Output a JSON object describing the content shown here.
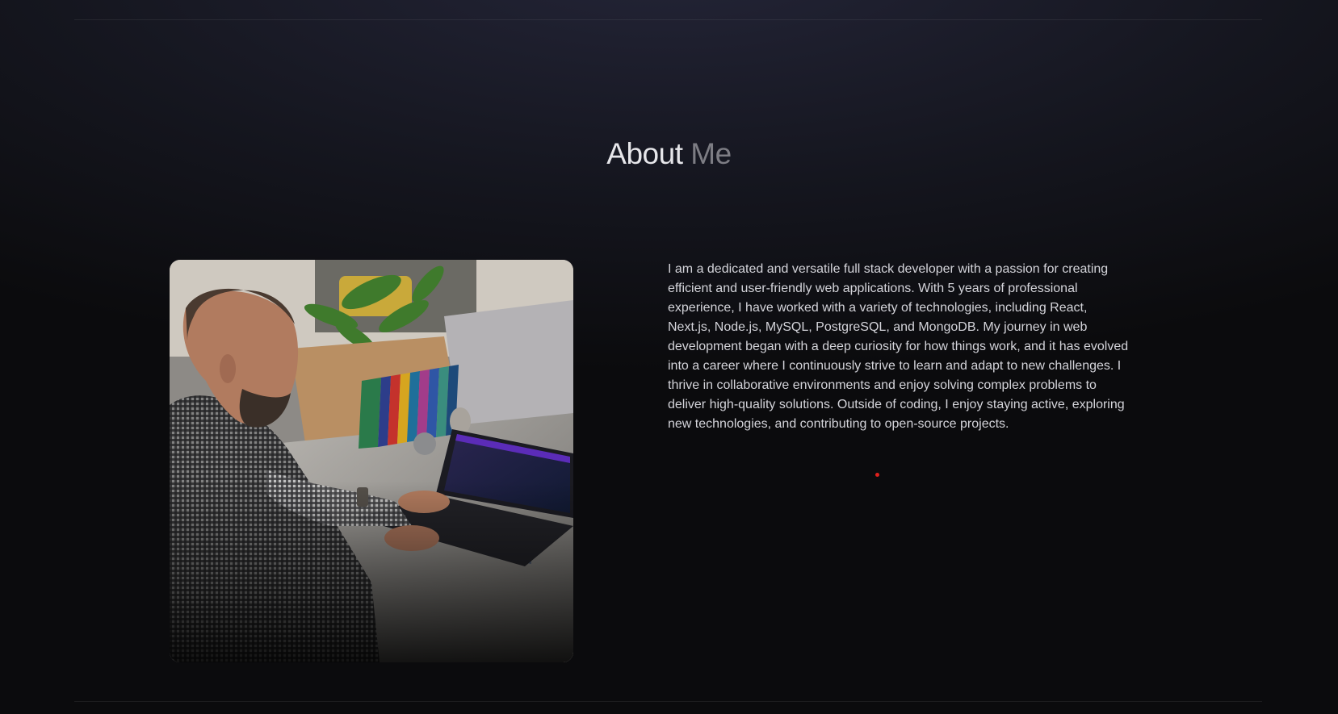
{
  "about": {
    "title_main": "About",
    "title_accent": "Me",
    "bio": "I am a dedicated and versatile full stack developer with a passion for creating efficient and user-friendly web applications. With 5 years of professional experience, I have worked with a variety of technologies, including React, Next.js, Node.js, MySQL, PostgreSQL, and MongoDB. My journey in web development began with a deep curiosity for how things work, and it has evolved into a career where I continuously strive to learn and adapt to new challenges. I thrive in collaborative environments and enjoy solving complex problems to deliver high-quality solutions. Outside of coding, I enjoy staying active, exploring new technologies, and contributing to open-source projects.",
    "photo_icon": "developer-at-laptop-photo"
  },
  "colors": {
    "background": "#0b0b0d",
    "title_main": "#e6e6ea",
    "title_accent": "#7d7d84",
    "body_text": "#d4d4da",
    "cursor": "#e0201c"
  }
}
